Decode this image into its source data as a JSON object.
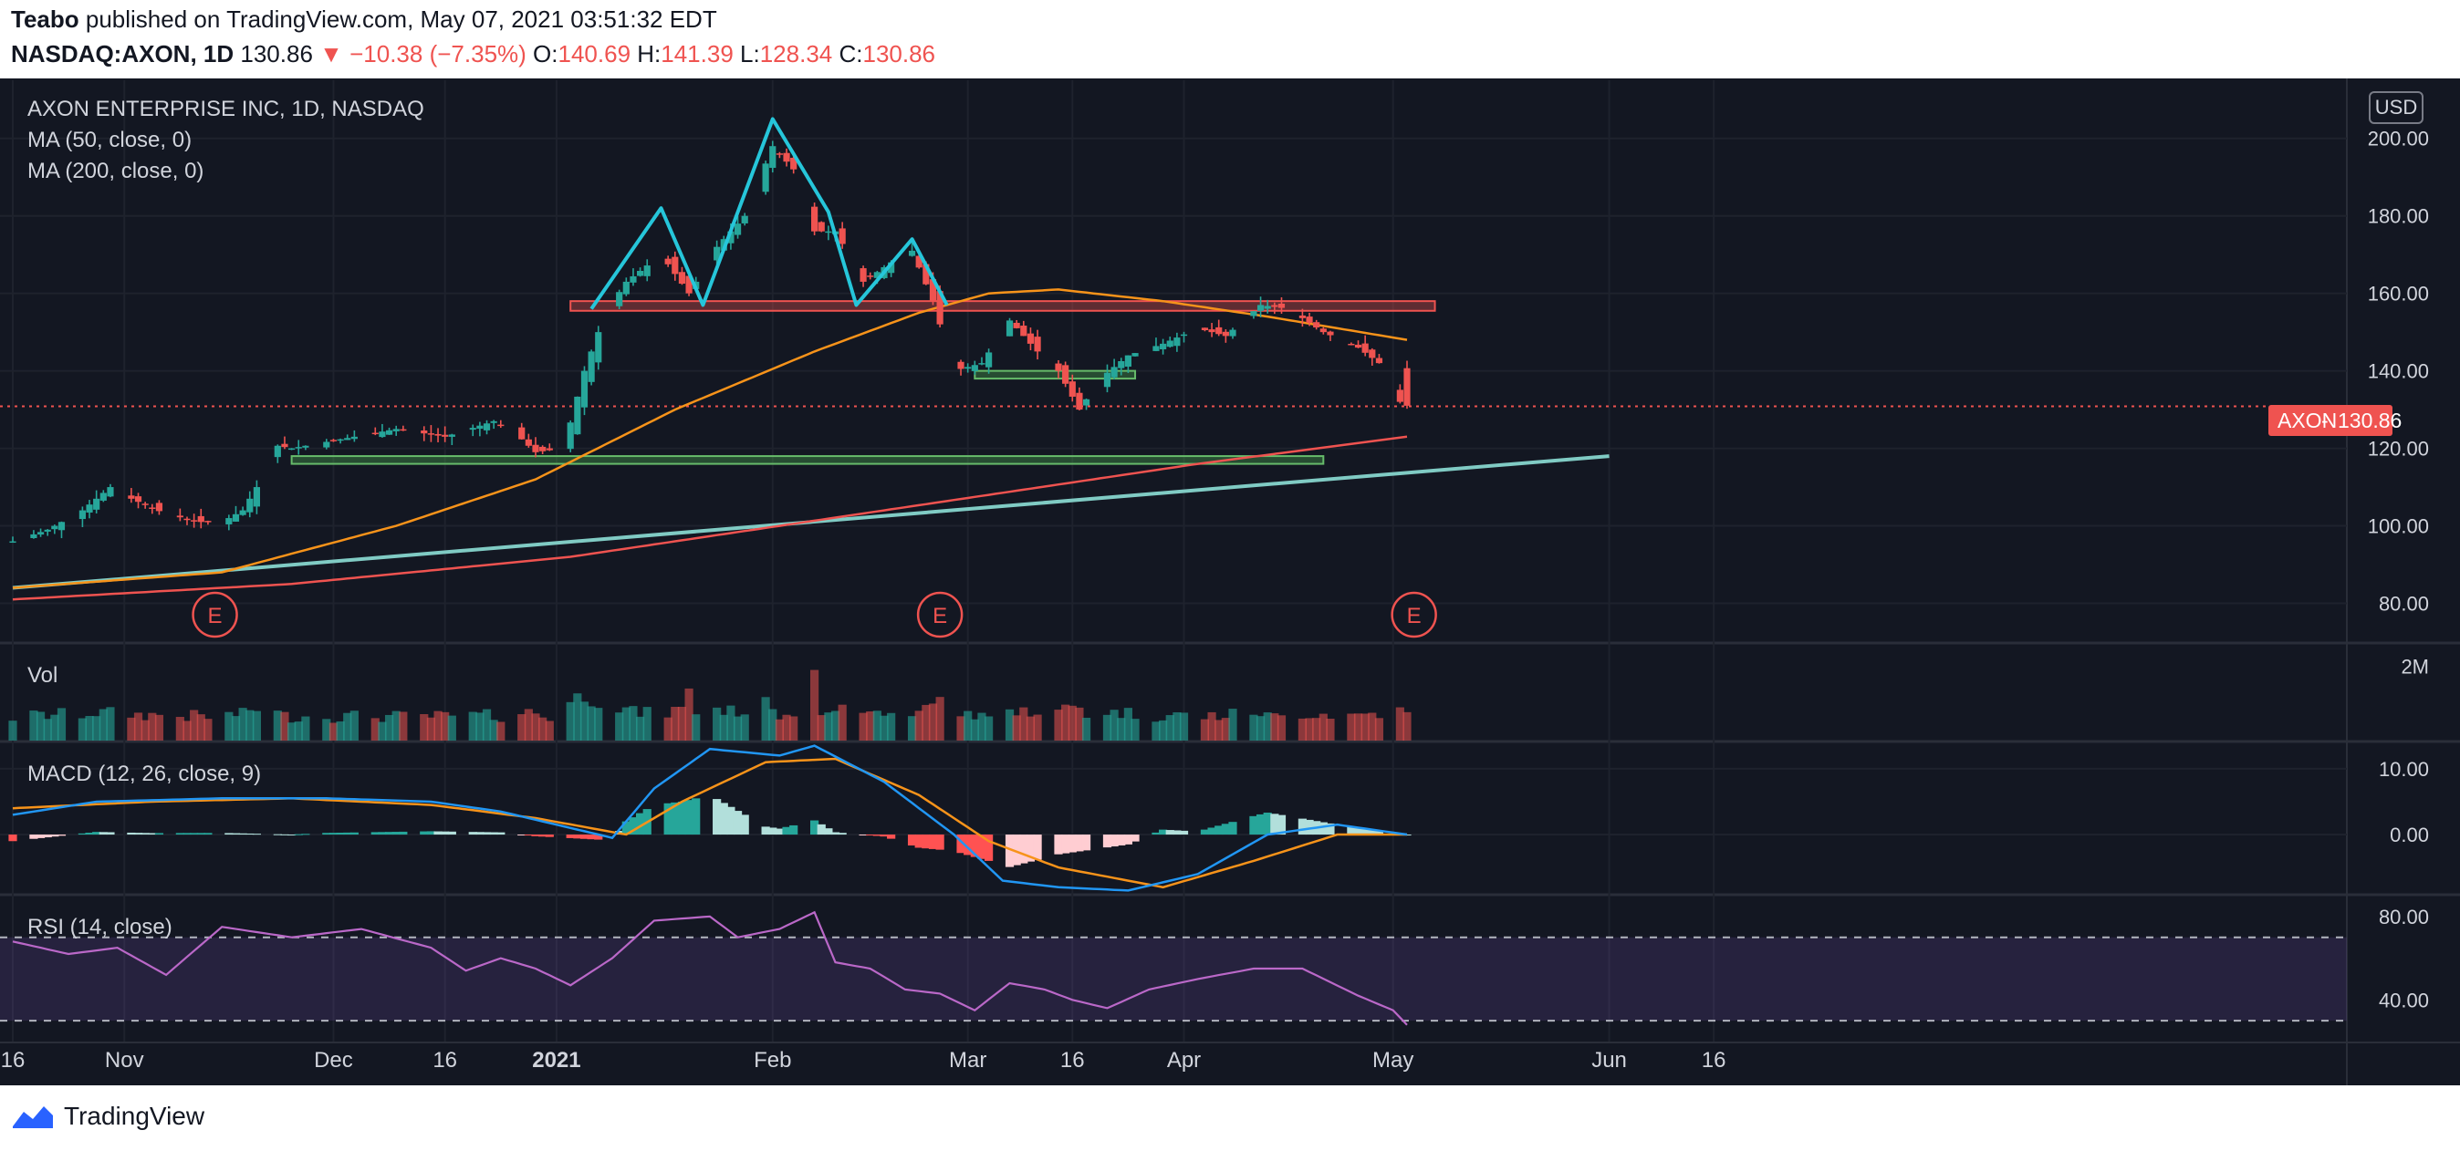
{
  "header": {
    "author": "Teabo",
    "published": "published on TradingView.com, May 07, 2021 03:51:32 EDT",
    "symbol": "NASDAQ:AXON, 1D",
    "last": "130.86",
    "change": "−10.38 (−7.35%)",
    "o_label": "O:",
    "o_val": "140.69",
    "h_label": "H:",
    "h_val": "141.39",
    "l_label": "L:",
    "l_val": "128.34",
    "c_label": "C:",
    "c_val": "130.86"
  },
  "legend": {
    "title": "AXON ENTERPRISE INC, 1D, NASDAQ",
    "ma50": "MA (50, close, 0)",
    "ma200": "MA (200, close, 0)",
    "vol": "Vol",
    "macd": "MACD (12, 26, close, 9)",
    "rsi": "RSI (14, close)"
  },
  "currency": "USD",
  "price_tag": {
    "symbol": "AXON",
    "value": "130.86"
  },
  "footer": {
    "brand": "TradingView"
  },
  "colors": {
    "up": "#26a69a",
    "down": "#ef5350",
    "ma50": "#f7931a",
    "ma200": "#ef5350",
    "trend": "#80cbc4",
    "pattern": "#26c6da",
    "rsi": "#ba68c8",
    "bg": "#131722"
  },
  "chart_data": [
    {
      "type": "candlestick",
      "panel": "price",
      "ylim": [
        70,
        215
      ],
      "y_ticks": [
        "80.00",
        "100.00",
        "120.00",
        "140.00",
        "160.00",
        "180.00",
        "200.00"
      ],
      "x_ticks": [
        "16",
        "Nov",
        "Dec",
        "16",
        "2021",
        "Feb",
        "Mar",
        "16",
        "Apr",
        "May",
        "Jun",
        "16"
      ],
      "x_tick_days": [
        0,
        16,
        46,
        62,
        78,
        109,
        137,
        152,
        168,
        198,
        229,
        244
      ],
      "start_date": "2020-10-16",
      "close_path": [
        [
          0,
          96
        ],
        [
          5,
          99
        ],
        [
          10,
          104
        ],
        [
          14,
          110
        ],
        [
          17,
          107
        ],
        [
          22,
          103
        ],
        [
          27,
          101
        ],
        [
          30,
          101
        ],
        [
          33,
          104
        ],
        [
          35,
          110
        ],
        [
          37,
          121
        ],
        [
          40,
          120
        ],
        [
          46,
          122
        ],
        [
          55,
          125
        ],
        [
          62,
          123
        ],
        [
          69,
          127
        ],
        [
          72,
          124
        ],
        [
          75,
          119
        ],
        [
          79,
          120
        ],
        [
          82,
          140
        ],
        [
          85,
          155
        ],
        [
          88,
          163
        ],
        [
          93,
          170
        ],
        [
          97,
          160
        ],
        [
          101,
          172
        ],
        [
          105,
          180
        ],
        [
          109,
          198
        ],
        [
          112,
          192
        ],
        [
          115,
          176
        ],
        [
          118,
          176
        ],
        [
          122,
          163
        ],
        [
          126,
          168
        ],
        [
          129,
          171
        ],
        [
          132,
          158
        ],
        [
          135,
          140
        ],
        [
          139,
          142
        ],
        [
          143,
          153
        ],
        [
          147,
          145
        ],
        [
          150,
          140
        ],
        [
          153,
          130
        ],
        [
          156,
          138
        ],
        [
          160,
          144
        ],
        [
          165,
          147
        ],
        [
          170,
          151
        ],
        [
          174,
          149
        ],
        [
          179,
          157
        ],
        [
          183,
          156
        ],
        [
          188,
          150
        ],
        [
          193,
          146
        ],
        [
          196,
          142
        ],
        [
          198,
          133
        ],
        [
          200,
          131
        ]
      ],
      "ma50_path": [
        [
          0,
          84
        ],
        [
          30,
          88
        ],
        [
          55,
          100
        ],
        [
          75,
          112
        ],
        [
          95,
          130
        ],
        [
          115,
          145
        ],
        [
          130,
          155
        ],
        [
          140,
          160
        ],
        [
          150,
          161
        ],
        [
          165,
          158
        ],
        [
          180,
          154
        ],
        [
          200,
          148
        ]
      ],
      "ma200_path": [
        [
          0,
          81
        ],
        [
          40,
          85
        ],
        [
          80,
          92
        ],
        [
          110,
          100
        ],
        [
          140,
          108
        ],
        [
          170,
          116
        ],
        [
          200,
          123
        ]
      ],
      "trendline": {
        "from": [
          0,
          84
        ],
        "to": [
          229,
          118
        ]
      },
      "support_zones": [
        {
          "from_day": 40,
          "to_day": 188,
          "low": 116,
          "high": 118
        },
        {
          "from_day": 138,
          "to_day": 161,
          "low": 138,
          "high": 140
        }
      ],
      "resistance_zone": {
        "from_day": 80,
        "to_day": 204,
        "low": 155.5,
        "high": 158
      },
      "pattern_points": [
        [
          83,
          156
        ],
        [
          93,
          182
        ],
        [
          99,
          157
        ],
        [
          109,
          205
        ],
        [
          117,
          181
        ],
        [
          121,
          157
        ],
        [
          129,
          174
        ],
        [
          134,
          157
        ]
      ],
      "last_price": 130.86,
      "earnings_days": [
        29,
        133,
        201
      ],
      "earnings_label": "E"
    },
    {
      "type": "bar",
      "panel": "volume",
      "y_ticks": [
        "2M"
      ],
      "note_values_in_millions": [
        0.5,
        2.0,
        1.6,
        0.6
      ]
    },
    {
      "type": "line",
      "panel": "macd",
      "y_ticks": [
        "10.00",
        "0.00"
      ],
      "ylim": [
        -9,
        14
      ],
      "macd_path": [
        [
          0,
          3
        ],
        [
          12,
          5
        ],
        [
          30,
          5.5
        ],
        [
          45,
          5.5
        ],
        [
          60,
          5
        ],
        [
          70,
          3.5
        ],
        [
          80,
          1
        ],
        [
          86,
          -0.5
        ],
        [
          92,
          7
        ],
        [
          100,
          13
        ],
        [
          110,
          12
        ],
        [
          115,
          13.5
        ],
        [
          125,
          8
        ],
        [
          135,
          0
        ],
        [
          142,
          -7
        ],
        [
          150,
          -8
        ],
        [
          160,
          -8.5
        ],
        [
          170,
          -6
        ],
        [
          180,
          0
        ],
        [
          190,
          1.5
        ],
        [
          200,
          0
        ]
      ],
      "signal_path": [
        [
          0,
          4
        ],
        [
          20,
          5
        ],
        [
          40,
          5.5
        ],
        [
          60,
          4.5
        ],
        [
          75,
          2.5
        ],
        [
          88,
          0
        ],
        [
          96,
          5
        ],
        [
          108,
          11
        ],
        [
          118,
          11.5
        ],
        [
          130,
          6
        ],
        [
          140,
          -1
        ],
        [
          150,
          -5
        ],
        [
          165,
          -8
        ],
        [
          178,
          -4
        ],
        [
          190,
          0
        ],
        [
          200,
          0
        ]
      ],
      "histogram": "macd_minus_signal"
    },
    {
      "type": "line",
      "panel": "rsi",
      "y_ticks": [
        "80.00",
        "40.00"
      ],
      "ylim": [
        20,
        90
      ],
      "bands": [
        70,
        30
      ],
      "rsi_path": [
        [
          0,
          68
        ],
        [
          8,
          62
        ],
        [
          15,
          65
        ],
        [
          22,
          52
        ],
        [
          30,
          75
        ],
        [
          40,
          70
        ],
        [
          50,
          74
        ],
        [
          60,
          65
        ],
        [
          65,
          54
        ],
        [
          70,
          60
        ],
        [
          75,
          55
        ],
        [
          80,
          47
        ],
        [
          86,
          60
        ],
        [
          92,
          78
        ],
        [
          100,
          80
        ],
        [
          104,
          70
        ],
        [
          110,
          74
        ],
        [
          115,
          82
        ],
        [
          118,
          58
        ],
        [
          123,
          55
        ],
        [
          128,
          45
        ],
        [
          133,
          43
        ],
        [
          138,
          35
        ],
        [
          143,
          48
        ],
        [
          148,
          45
        ],
        [
          152,
          40
        ],
        [
          157,
          36
        ],
        [
          163,
          45
        ],
        [
          170,
          50
        ],
        [
          178,
          55
        ],
        [
          185,
          55
        ],
        [
          193,
          42
        ],
        [
          198,
          35
        ],
        [
          200,
          28
        ]
      ]
    }
  ]
}
